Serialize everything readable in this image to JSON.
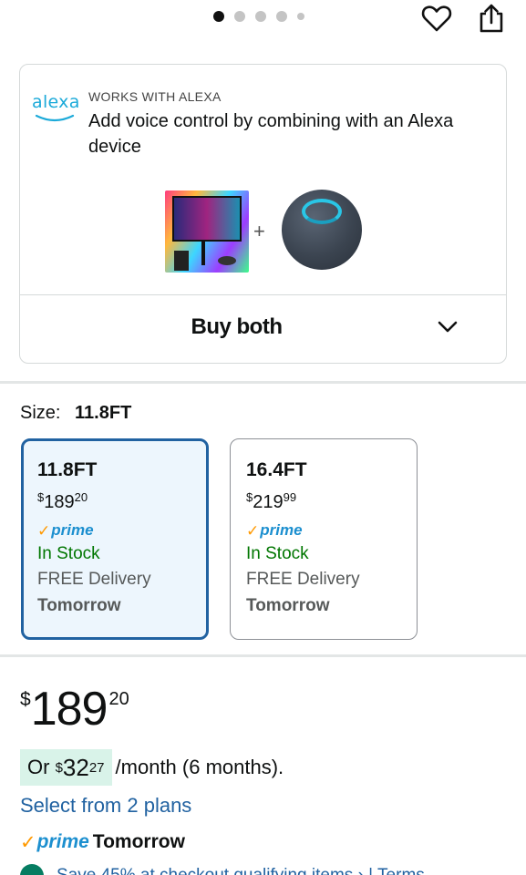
{
  "carousel": {
    "dot_count": 5,
    "active_index": 0
  },
  "alexa": {
    "logo_text": "alexa",
    "kicker": "WORKS WITH ALEXA",
    "description": "Add voice control by combining with an Alexa device",
    "plus_sign": "+",
    "buy_both_label": "Buy both"
  },
  "size": {
    "label": "Size:",
    "selected": "11.8FT",
    "options": [
      {
        "name": "11.8FT",
        "currency": "$",
        "whole": "189",
        "fraction": "20",
        "prime": "prime",
        "stock": "In Stock",
        "delivery": "FREE Delivery",
        "when": "Tomorrow"
      },
      {
        "name": "16.4FT",
        "currency": "$",
        "whole": "219",
        "fraction": "99",
        "prime": "prime",
        "stock": "In Stock",
        "delivery": "FREE Delivery",
        "when": "Tomorrow"
      }
    ]
  },
  "price": {
    "currency": "$",
    "whole": "189",
    "fraction": "20",
    "monthly_prefix": "Or",
    "monthly_currency": "$",
    "monthly_whole": "32",
    "monthly_fraction": "27",
    "monthly_suffix": "/month (6 months).",
    "plans_link": "Select from 2 plans",
    "prime_word": "prime",
    "prime_when": "Tomorrow",
    "promo_text": "Save 45% at checkout  qualifying items ›  |  Terms"
  },
  "colors": {
    "link": "#2162a1",
    "stock": "#007600",
    "prime_blue": "#1c8fcf",
    "prime_check": "#ff9900",
    "alexa_blue": "#1caad9"
  }
}
